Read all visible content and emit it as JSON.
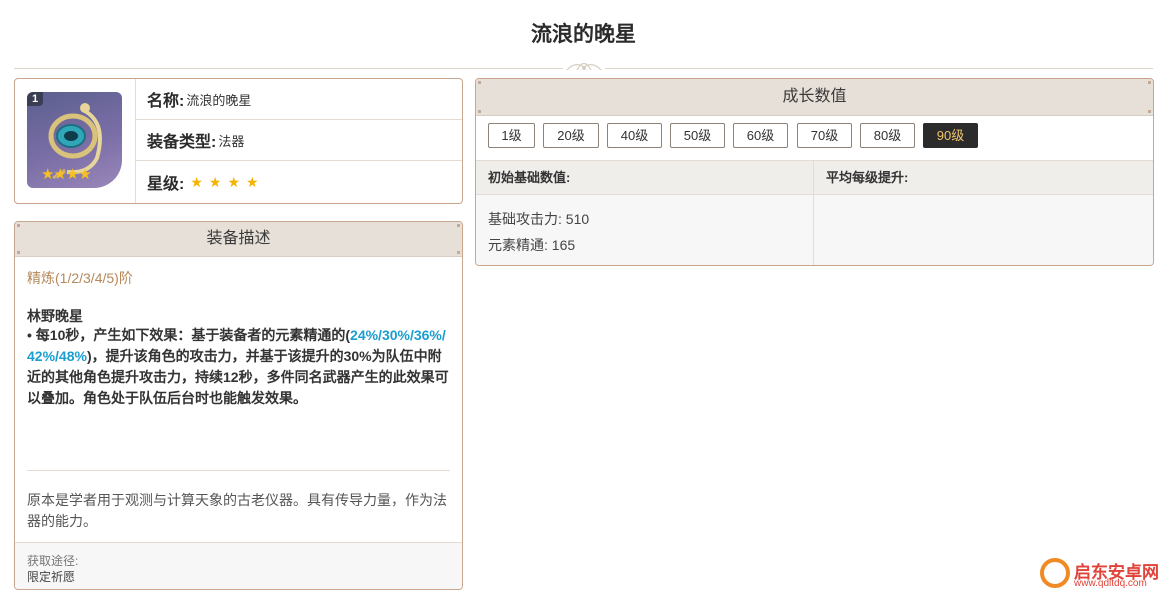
{
  "page": {
    "title": "流浪的晚星"
  },
  "info": {
    "refine_badge": "1",
    "name_key": "名称:",
    "name_value": "流浪的晚星",
    "type_key": "装备类型:",
    "type_value": "法器",
    "rarity_key": "星级:",
    "rarity_count": 4,
    "rarity_stars": "★★★★",
    "thumb_stars": "★★★★"
  },
  "description": {
    "header": "装备描述",
    "refine_label": "精炼(1/2/3/4/5)阶",
    "skill_name": "林野晚星",
    "skill_part1": "• 每10秒，产生如下效果：基于装备者的元素精通的(",
    "skill_highlight": "24%/30%/36%/42%/48%",
    "skill_part2": ")，提升该角色的攻击力，并基于该提升的30%为队伍中附近的其他角色提升攻击力，持续12秒，多件同名武器产生的此效果可以叠加。角色处于队伍后台时也能触发效果。",
    "lore": "原本是学者用于观测与计算天象的古老仪器。具有传导力量，作为法器的能力。",
    "source_label": "获取途径:",
    "source_value": "限定祈愿"
  },
  "growth": {
    "header": "成长数值",
    "levels": [
      "1级",
      "20级",
      "40级",
      "50级",
      "60级",
      "70级",
      "80级",
      "90级"
    ],
    "active_level": "90级",
    "base_header": "初始基础数值:",
    "avg_header": "平均每级提升:",
    "base_attack": "基础攻击力: 510",
    "elemental_mastery": "元素精通: 165"
  },
  "watermark": {
    "name": "启东安卓网",
    "url": "www.qdltdq.com"
  },
  "colors": {
    "accent_border": "#c9a58d",
    "highlight": "#1a9ed0",
    "refine": "#b5885a",
    "active_btn": "#2b2b2b",
    "star": "#f5b300"
  }
}
